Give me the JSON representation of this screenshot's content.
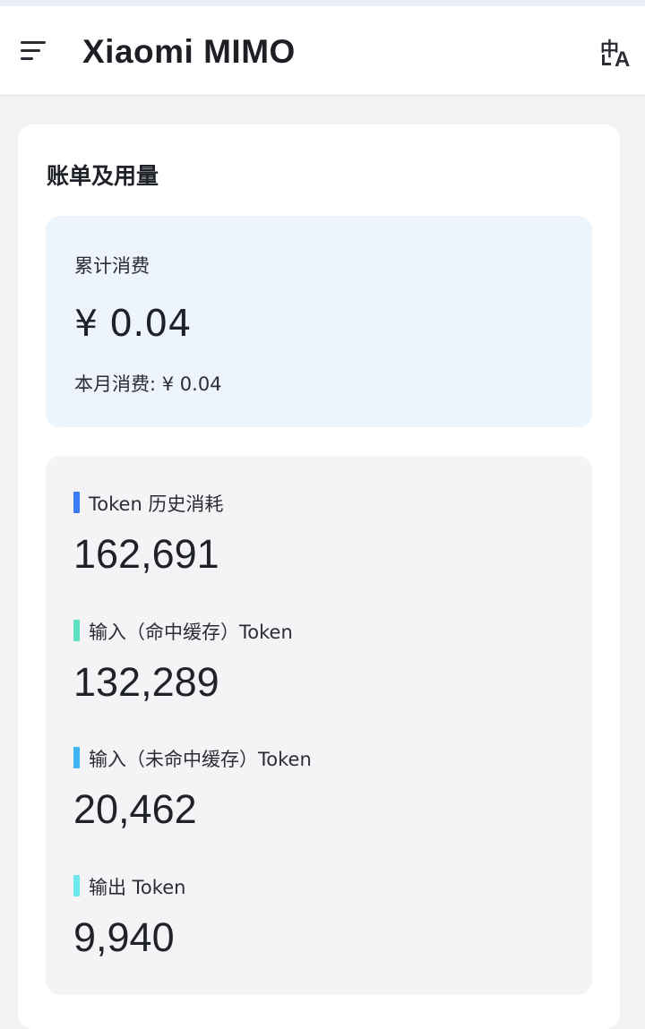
{
  "header": {
    "brand": "Xiaomi MIMO",
    "lang_zh": "中",
    "lang_en": "A"
  },
  "billing": {
    "title": "账单及用量",
    "total_label": "累计消费",
    "total_value": "¥ 0.04",
    "month_text": "本月消费: ¥ 0.04"
  },
  "tokens": [
    {
      "label": "Token 历史消耗",
      "value": "162,691",
      "color": "#3c7bf6"
    },
    {
      "label": "输入（命中缓存）Token",
      "value": "132,289",
      "color": "#5de0c0"
    },
    {
      "label": "输入（未命中缓存）Token",
      "value": "20,462",
      "color": "#3fb4f2"
    },
    {
      "label": "输出 Token",
      "value": "9,940",
      "color": "#6ce8ee"
    }
  ]
}
